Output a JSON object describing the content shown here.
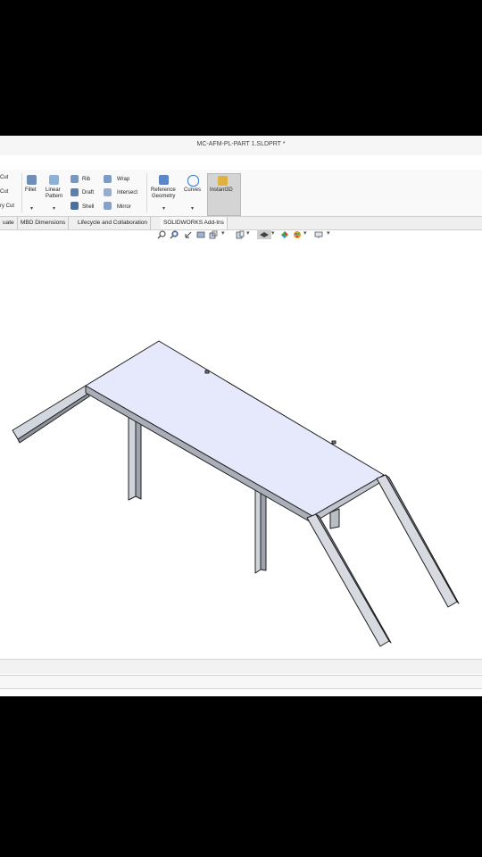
{
  "window": {
    "title": "MC-AFM-PL-PART 1.SLDPRT *"
  },
  "ribbon": {
    "cut_items": [
      "Cut",
      "Cut",
      "ry Cut"
    ],
    "fillet": "Fillet",
    "linear_pattern_1": "Linear",
    "linear_pattern_2": "Pattern",
    "rib": "Rib",
    "draft": "Draft",
    "shell": "Shell",
    "wrap": "Wrap",
    "intersect": "Intersect",
    "mirror": "Mirror",
    "reference_geometry_1": "Reference",
    "reference_geometry_2": "Geometry",
    "curves": "Curves",
    "instant3d": "Instant3D"
  },
  "tabs": [
    {
      "label": "uate"
    },
    {
      "label": "MBD Dimensions"
    },
    {
      "label": "Lifecycle and Collaboration"
    },
    {
      "label": "SOLIDWORKS Add-Ins"
    }
  ],
  "colors": {
    "accent_blue": "#3a7bd5",
    "top_face": "#e6e9fb",
    "steel": "#d9dce3",
    "edge": "#222222",
    "instant_bg": "#d4d4d4"
  }
}
